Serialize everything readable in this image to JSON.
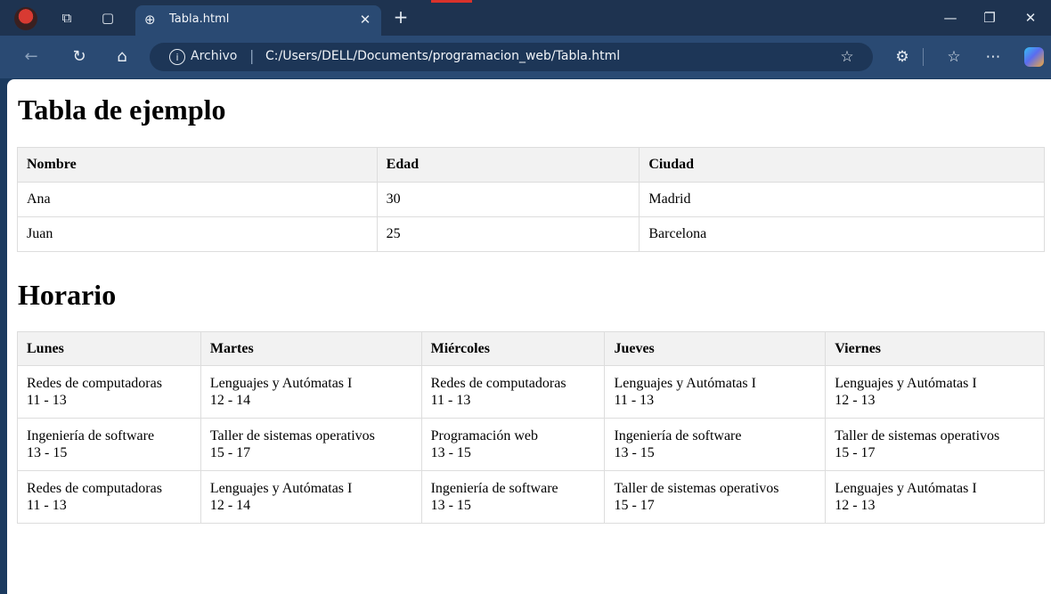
{
  "browser": {
    "tab_title": "Tabla.html",
    "site_label": "Archivo",
    "url": "C:/Users/DELL/Documents/programacion_web/Tabla.html"
  },
  "page": {
    "title1": "Tabla de ejemplo",
    "table1": {
      "headers": [
        "Nombre",
        "Edad",
        "Ciudad"
      ],
      "rows": [
        [
          "Ana",
          "30",
          "Madrid"
        ],
        [
          "Juan",
          "25",
          "Barcelona"
        ]
      ]
    },
    "title2": "Horario",
    "table2": {
      "headers": [
        "Lunes",
        "Martes",
        "Miércoles",
        "Jueves",
        "Viernes"
      ],
      "rows": [
        [
          {
            "subject": "Redes de computadoras",
            "time": "11 - 13"
          },
          {
            "subject": "Lenguajes y Autómatas I",
            "time": "12 - 14"
          },
          {
            "subject": "Redes de computadoras",
            "time": "11 - 13"
          },
          {
            "subject": "Lenguajes y Autómatas I",
            "time": "11 - 13"
          },
          {
            "subject": "Lenguajes y Autómatas I",
            "time": "12 - 13"
          }
        ],
        [
          {
            "subject": "Ingeniería de software",
            "time": "13 - 15"
          },
          {
            "subject": "Taller de sistemas operativos",
            "time": "15 - 17"
          },
          {
            "subject": "Programación web",
            "time": "13 - 15"
          },
          {
            "subject": "Ingeniería de software",
            "time": "13 - 15"
          },
          {
            "subject": "Taller de sistemas operativos",
            "time": "15 - 17"
          }
        ],
        [
          {
            "subject": "Redes de computadoras",
            "time": "11 - 13"
          },
          {
            "subject": "Lenguajes y Autómatas I",
            "time": "12 - 14"
          },
          {
            "subject": "Ingeniería de software",
            "time": "13 - 15"
          },
          {
            "subject": "Taller de sistemas operativos",
            "time": "15 - 17"
          },
          {
            "subject": "Lenguajes y Autómatas I",
            "time": "12 - 13"
          }
        ]
      ]
    }
  }
}
